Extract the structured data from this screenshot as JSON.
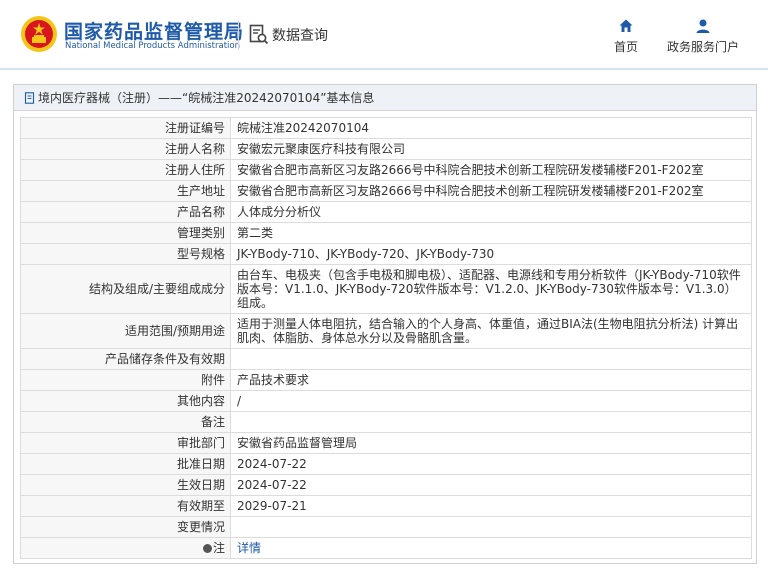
{
  "header": {
    "brand_cn": "国家药品监督管理局",
    "brand_en": "National Medical Products Administration",
    "query_label": "数据查询",
    "nav": [
      {
        "label": "首页",
        "icon": "home-icon"
      },
      {
        "label": "政务服务门户",
        "icon": "user-icon"
      }
    ]
  },
  "breadcrumb": "境内医疗器械（注册）——“皖械注准20242070104”基本信息",
  "fields": [
    {
      "label": "注册证编号",
      "value": "皖械注准20242070104"
    },
    {
      "label": "注册人名称",
      "value": "安徽宏元聚康医疗科技有限公司"
    },
    {
      "label": "注册人住所",
      "value": "安徽省合肥市高新区习友路2666号中科院合肥技术创新工程院研发楼辅楼F201-F202室"
    },
    {
      "label": "生产地址",
      "value": "安徽省合肥市高新区习友路2666号中科院合肥技术创新工程院研发楼辅楼F201-F202室"
    },
    {
      "label": "产品名称",
      "value": "人体成分分析仪"
    },
    {
      "label": "管理类别",
      "value": "第二类"
    },
    {
      "label": "型号规格",
      "value": "JK-YBody-710、JK-YBody-720、JK-YBody-730"
    },
    {
      "label": "结构及组成/主要组成成分",
      "value": "由台车、电极夹（包含手电极和脚电极）、适配器、电源线和专用分析软件（JK-YBody-710软件版本号：V1.1.0、JK-YBody-720软件版本号：V1.2.0、JK-YBody-730软件版本号：V1.3.0）组成。"
    },
    {
      "label": "适用范围/预期用途",
      "value": "适用于测量人体电阻抗，结合输入的个人身高、体重值，通过BIA法(生物电阻抗分析法) 计算出肌肉、体脂肪、身体总水分以及骨骼肌含量。"
    },
    {
      "label": "产品储存条件及有效期",
      "value": ""
    },
    {
      "label": "附件",
      "value": "产品技术要求"
    },
    {
      "label": "其他内容",
      "value": "/"
    },
    {
      "label": "备注",
      "value": ""
    },
    {
      "label": "审批部门",
      "value": "安徽省药品监督管理局"
    },
    {
      "label": "批准日期",
      "value": "2024-07-22"
    },
    {
      "label": "生效日期",
      "value": "2024-07-22"
    },
    {
      "label": "有效期至",
      "value": "2029-07-21"
    },
    {
      "label": "变更情况",
      "value": ""
    },
    {
      "label": "注",
      "value": "详情"
    }
  ],
  "colors": {
    "brand_blue": "#1f5aa8",
    "emblem_red": "#d7161e",
    "emblem_gold": "#f5c518"
  }
}
